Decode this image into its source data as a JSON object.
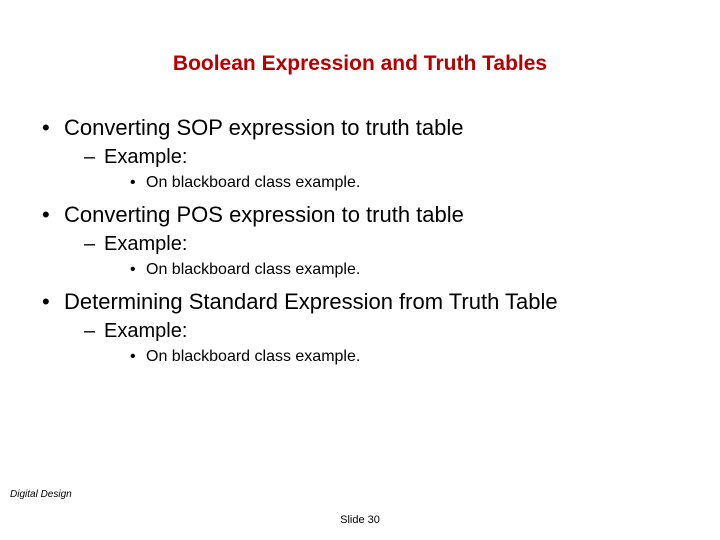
{
  "title": "Boolean Expression and Truth Tables",
  "items": [
    {
      "level": 1,
      "text": "Converting SOP expression to truth table"
    },
    {
      "level": 2,
      "text": "Example:"
    },
    {
      "level": 3,
      "text": "On blackboard class example."
    },
    {
      "level": 1,
      "text": "Converting POS expression to truth table"
    },
    {
      "level": 2,
      "text": "Example:"
    },
    {
      "level": 3,
      "text": "On blackboard class example."
    },
    {
      "level": 1,
      "text": "Determining Standard Expression from Truth Table"
    },
    {
      "level": 2,
      "text": "Example:"
    },
    {
      "level": 3,
      "text": "On blackboard class example."
    }
  ],
  "footer": {
    "left": "Digital Design",
    "center": "Slide 30"
  }
}
